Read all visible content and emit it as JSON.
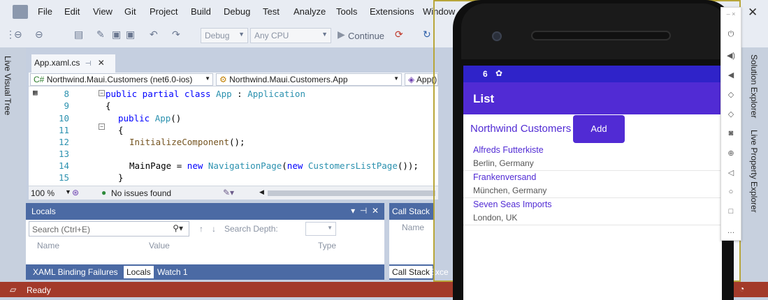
{
  "menu": [
    "File",
    "Edit",
    "View",
    "Git",
    "Project",
    "Build",
    "Debug",
    "Test",
    "Analyze",
    "Tools",
    "Extensions",
    "Window"
  ],
  "toolbar": {
    "config": "Debug",
    "platform": "Any CPU",
    "continue": "Continue"
  },
  "left_strip": "Live Visual Tree",
  "right_strip": [
    "Solution Explorer",
    "Live Property Explorer"
  ],
  "editor": {
    "tab": "App.xaml.cs",
    "nav": {
      "project": "Northwind.Maui.Customers (net6.0-ios)",
      "type": "Northwind.Maui.Customers.App",
      "member": "App()"
    },
    "lines": [
      "8",
      "9",
      "10",
      "11",
      "12",
      "13",
      "14",
      "15"
    ],
    "zoom": "100 %",
    "issues": "No issues found"
  },
  "locals": {
    "title": "Locals",
    "search_placeholder": "Search (Ctrl+E)",
    "search_depth": "Search Depth:",
    "columns": [
      "Name",
      "Value",
      "Type"
    ],
    "tabs": [
      "XAML Binding Failures",
      "Locals",
      "Watch 1"
    ]
  },
  "callstack": {
    "title": "Call Stack",
    "column": "Name",
    "tabs": [
      "Call Stack",
      "Exce"
    ]
  },
  "status": "Ready",
  "app": {
    "time": "6",
    "title": "List",
    "header": "Northwind Customers",
    "add_label": "Add",
    "customers": [
      {
        "name": "Alfreds Futterkiste",
        "location": "Berlin, Germany"
      },
      {
        "name": "Frankenversand",
        "location": "München, Germany"
      },
      {
        "name": "Seven Seas Imports",
        "location": "London, UK"
      }
    ]
  },
  "colors": {
    "accent": "#512bd4",
    "status_bar": "#a33a2a",
    "panel_header": "#4b6aa4"
  }
}
